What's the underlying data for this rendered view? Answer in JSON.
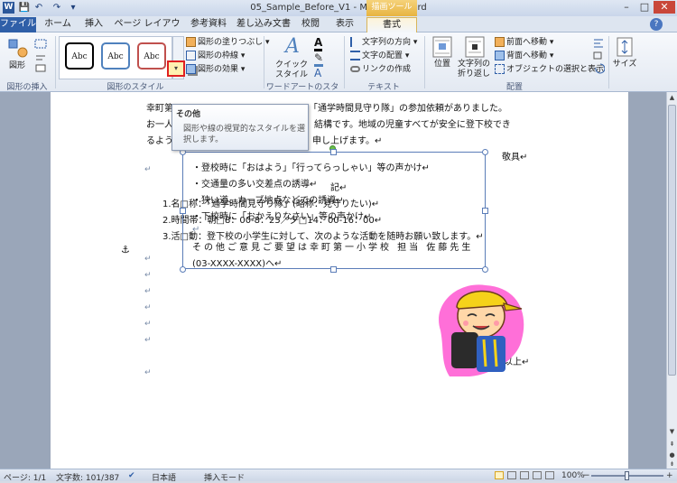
{
  "window": {
    "app_icon": "W",
    "title": "05_Sample_Before_V1 - Microsoft Word",
    "context_tab_header": "描画ツール",
    "quick_access": [
      {
        "icon": "save-icon",
        "glyph": "💾"
      },
      {
        "icon": "undo-icon",
        "glyph": "↶"
      },
      {
        "icon": "redo-icon",
        "glyph": "↷"
      },
      {
        "icon": "customize-qat-icon",
        "glyph": "▾"
      }
    ],
    "controls": {
      "minimize": "–",
      "maximize": "□",
      "close": "✕",
      "help": "?"
    }
  },
  "tabs": [
    {
      "label": "ファイル"
    },
    {
      "label": "ホーム"
    },
    {
      "label": "挿入"
    },
    {
      "label": "ページ レイアウト"
    },
    {
      "label": "参考資料"
    },
    {
      "label": "差し込み文書"
    },
    {
      "label": "校閲"
    },
    {
      "label": "表示"
    },
    {
      "label": "書式"
    }
  ],
  "ribbon": {
    "insert_shapes": {
      "shape_button": "図形",
      "group": "図形の挿入"
    },
    "shape_styles": {
      "gallery": [
        {
          "label": "Abc",
          "color": "#000000"
        },
        {
          "label": "Abc",
          "color": "#4f81bd"
        },
        {
          "label": "Abc",
          "color": "#c0504d"
        }
      ],
      "fill": "図形の塗りつぶし",
      "outline": "図形の枠線",
      "effects": "図形の効果",
      "more_button": "▾",
      "group": "図形のスタイル"
    },
    "wordart": {
      "quick_style": "クイック\nスタイル",
      "group": "ワードアートのスタイル"
    },
    "text": {
      "direction": "文字列の方向",
      "align": "文字の配置",
      "link": "リンクの作成",
      "group": "テキスト"
    },
    "arrange": {
      "position": "位置",
      "wrap": "文字列の\n折り返し",
      "bring_forward": "前面へ移動",
      "send_backward": "背面へ移動",
      "selection_pane": "オブジェクトの選択と表示",
      "group": "配置"
    },
    "size": {
      "label": "サイズ"
    }
  },
  "tooltip": {
    "title": "その他",
    "description": "図形や線の視覚的なスタイルを選択します。"
  },
  "document": {
    "lines": [
      {
        "text": "幸町第"
      },
      {
        "text": "「通学時間見守り隊」の参加依頼がありました。"
      },
      {
        "text": "お一人"
      },
      {
        "text": "結構です。地域の児童すべてが安全に登下校でき"
      },
      {
        "text": "るよう"
      },
      {
        "text": "申し上げます。↵"
      },
      {
        "text": "敬具↵"
      },
      {
        "text": "記↵"
      },
      {
        "text": "1.名□称：「通学時間見守り隊」(略称：見守りたい)↵"
      },
      {
        "text": "2.時間帯：朝□8：00-8：25／夕□14：00-16：00↵"
      },
      {
        "text": "3.活□動：登下校の小学生に対して、次のような活動を随時お願い致します。↵"
      },
      {
        "text": "以上↵"
      }
    ],
    "textbox_lines": [
      {
        "text": "・登校時に「おはよう」「行ってらっしゃい」等の声かけ↵"
      },
      {
        "text": "・交通量の多い交差点の誘導↵"
      },
      {
        "text": "・狭い道、カーブ地点などでの誘導↵"
      },
      {
        "text": "・下校時に「おかえりなさい」等の声かけ↵"
      },
      {
        "text": "↵"
      },
      {
        "text": "その他ご意見ご要望は幸町第一小学校 担当 佐藤先生"
      },
      {
        "text": "(03-XXXX-XXXX)へ↵"
      }
    ],
    "paragraph_mark": "↵",
    "anchor": "⚓"
  },
  "statusbar": {
    "page": "ページ: 1/1",
    "words": "文字数: 101/387",
    "language": "日本語",
    "mode": "挿入モード",
    "zoom": "100%",
    "zoom_minus": "−",
    "zoom_plus": "+"
  }
}
